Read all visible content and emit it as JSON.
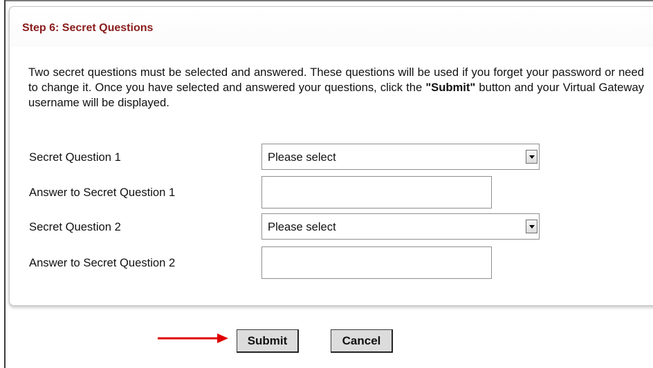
{
  "step": {
    "title": "Step 6: Secret Questions"
  },
  "intro": {
    "text_before": "Two secret questions must be selected and answered. These questions will be used if you forget your password or need to change it. Once you have selected and answered your questions, click the ",
    "bold": "\"Submit\"",
    "text_after": " button and your Virtual Gateway username will be displayed."
  },
  "form": {
    "question1": {
      "label": "Secret Question 1",
      "selected": "Please select"
    },
    "answer1": {
      "label": "Answer to Secret Question 1",
      "value": ""
    },
    "question2": {
      "label": "Secret Question 2",
      "selected": "Please select"
    },
    "answer2": {
      "label": "Answer to Secret Question 2",
      "value": ""
    }
  },
  "buttons": {
    "submit": "Submit",
    "cancel": "Cancel"
  },
  "colors": {
    "title": "#8a1c1c",
    "arrow": "#e00000",
    "button_bg": "#dcdcdc"
  },
  "icons": {
    "dropdown": "chevron-down-icon",
    "pointer": "red-arrow-icon"
  }
}
